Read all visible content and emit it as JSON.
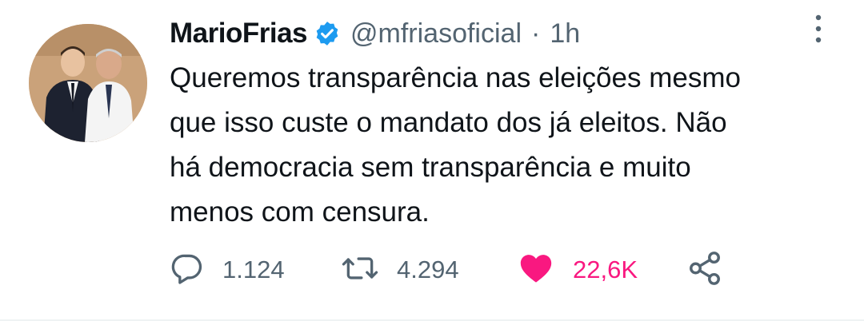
{
  "tweet": {
    "display_name": "MarioFrias",
    "handle": "@mfriasoficial",
    "separator": "·",
    "time": "1h",
    "text_lines": [
      "Queremos transparência nas eleições mesmo",
      "que isso custe o mandato dos já eleitos. Não",
      "há democracia sem transparência e muito",
      "menos com censura."
    ],
    "replies": "1.124",
    "retweets": "4.294",
    "likes": "22,6K",
    "liked": true
  },
  "icons": {
    "verified": "verified-badge-icon",
    "more": "more-vertical-icon",
    "reply": "reply-icon",
    "retweet": "retweet-icon",
    "like": "heart-icon",
    "share": "share-icon"
  },
  "colors": {
    "text": "#0f1419",
    "secondary": "#536471",
    "verified": "#1d9bf0",
    "like": "#f91880"
  }
}
